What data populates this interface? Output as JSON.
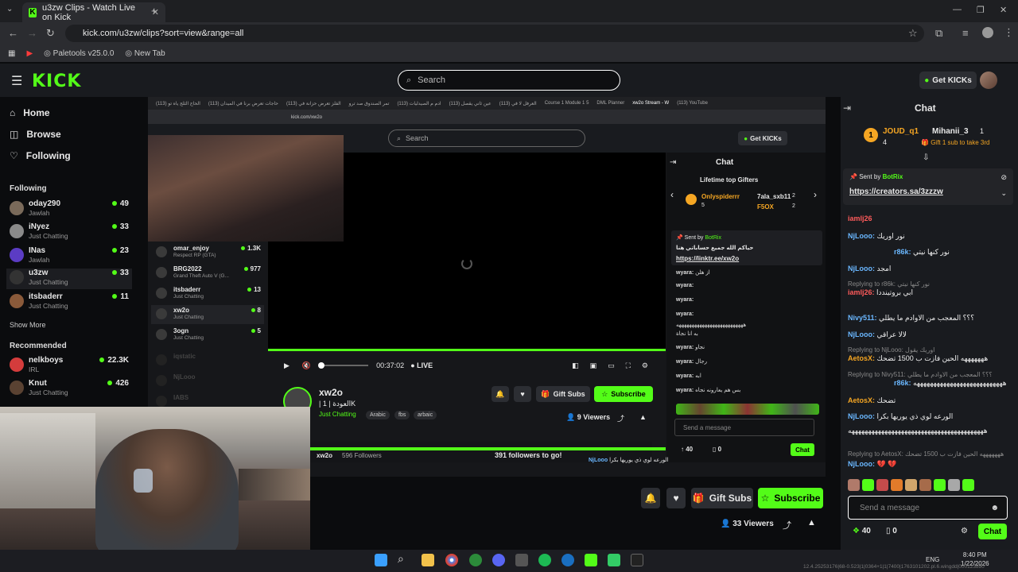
{
  "browser": {
    "tab_title": "u3zw Clips - Watch Live on Kick",
    "url": "kick.com/u3zw/clips?sort=view&range=all",
    "bookmarks": [
      "Paletools v25.0.0",
      "New Tab"
    ]
  },
  "header": {
    "logo": "KICK",
    "search_placeholder": "Search",
    "get_kicks": "Get KICKs"
  },
  "sidebar": {
    "nav": [
      "Home",
      "Browse",
      "Following"
    ],
    "following_title": "Following",
    "following": [
      {
        "name": "oday290",
        "category": "Jawlah",
        "viewers": "49",
        "color": "#7a6a5a"
      },
      {
        "name": "iNyez",
        "category": "Just Chatting",
        "viewers": "33",
        "color": "#8a8a8a"
      },
      {
        "name": "INas",
        "category": "Jawlah",
        "viewers": "23",
        "color": "#5b3cc4"
      },
      {
        "name": "u3zw",
        "category": "Just Chatting",
        "viewers": "33",
        "color": "#222"
      },
      {
        "name": "itsbaderr",
        "category": "Just Chatting",
        "viewers": "11",
        "color": "#8a5a3a"
      }
    ],
    "show_more": "Show More",
    "recommended_title": "Recommended",
    "recommended": [
      {
        "name": "nelkboys",
        "category": "IRL",
        "viewers": "22.3K",
        "color": "#d43c3c"
      },
      {
        "name": "Knut",
        "category": "Just Chatting",
        "viewers": "426",
        "color": "#5a4232"
      }
    ]
  },
  "shared_screen": {
    "tabs": [
      "(113) الحاج الثلج ياه تو",
      "(113) حاجات تعرض برنا في الميدان",
      "(113) الفلز تعرض حزانة في",
      "تمر الصندوق صد ترو",
      "(113) ادم م الصيدليات",
      "(113) عين ثاني يقصل",
      "(113) العرفل لا في",
      "Course 1 Module 1 5",
      "DML Planner",
      "xw2o Stream - W",
      "(113) YouTube"
    ],
    "url": "kick.com/xw2o",
    "search": "Search",
    "get_kicks": "Get KICKs",
    "time": "00:37:02",
    "live": "LIVE",
    "list": [
      {
        "name": "omar_enjoy",
        "category": "Respect RP (GTA)",
        "viewers": "1.3K",
        "dim": false
      },
      {
        "name": "BRG2022",
        "category": "Grand Theft Auto V (G...",
        "viewers": "977",
        "dim": false
      },
      {
        "name": "itsbaderr",
        "category": "Just Chatting",
        "viewers": "13",
        "dim": false
      },
      {
        "name": "xw2o",
        "category": "Just Chatting",
        "viewers": "8",
        "dim": false
      },
      {
        "name": "3ogn",
        "category": "Just Chatting",
        "viewers": "5",
        "dim": false
      },
      {
        "name": "iqstatic",
        "category": "",
        "viewers": "",
        "dim": true
      },
      {
        "name": "NjLooo",
        "category": "",
        "viewers": "",
        "dim": true
      },
      {
        "name": "IABS",
        "category": "",
        "viewers": "",
        "dim": true
      }
    ],
    "streamer": {
      "name": "xw2o",
      "title": "| العودة | 1K",
      "category": "Just Chatting",
      "tags": [
        "Arabic",
        "fbs",
        "arbaic"
      ],
      "viewers": "9 Viewers",
      "followers_name": "xw2o",
      "followers_count": "596 Followers",
      "followers_goal": "391 followers to go!"
    },
    "buttons": {
      "gift": "Gift Subs",
      "subscribe": "Subscribe"
    },
    "chat": {
      "title": "Chat",
      "gifters_title": "Lifetime top Gifters",
      "gifter1": "Onlyspiderrr",
      "gifter1_count": "5",
      "gifter2": "7ala_sxb11",
      "gifter2_count": "2",
      "gifter3": "F5OX",
      "gifter3_count": "2",
      "pinned_by": "Sent by",
      "pinned_user": "BotRix",
      "pinned_text": "حياكم الله جميع حساباتي هنا",
      "pinned_link": "https://linktr.ee/xw2o",
      "messages": [
        {
          "user": "wyara:",
          "text": "از هلن"
        },
        {
          "user": "wyara:",
          "text": ""
        },
        {
          "user": "wyara:",
          "text": ""
        },
        {
          "user": "wyara:",
          "text": ""
        },
        {
          "user": "",
          "text": "ههههههههههههههههههههههههههه"
        },
        {
          "user": "",
          "text": "به انا نجاة"
        },
        {
          "user": "wyara:",
          "text": "نجاو"
        },
        {
          "user": "wyara:",
          "text": "رجال"
        },
        {
          "user": "wyara:",
          "text": "ابه"
        },
        {
          "user": "wyara:",
          "text": "بس هم يعارونه نجاه"
        }
      ],
      "input": "Send a message",
      "count_a": "40",
      "count_b": "0",
      "send": "Chat",
      "bottom_user": "NjLooo",
      "bottom_text": "الورعه لوي ذي يوريها بكرا"
    }
  },
  "main_actions": {
    "gift": "Gift Subs",
    "subscribe": "Subscribe",
    "viewers": "33 Viewers"
  },
  "chat": {
    "title": "Chat",
    "gifter1_name": "JOUD_q1",
    "gifter1_count": "4",
    "gifter2_name": "Mihanii_3",
    "gifter2_count": "1",
    "gift_hint": "Gift 1 sub to take 3rd",
    "pinned_sent": "Sent by",
    "pinned_user": "BotRix",
    "pinned_link": "https://creators.sa/3zzzw",
    "messages": [
      {
        "user": "iamlj26",
        "text": "",
        "color": "#ff5b5b",
        "reply": ""
      },
      {
        "user": "NjLooo:",
        "text": "نور اوريك",
        "color": "#6ab7ff",
        "reply": ""
      },
      {
        "user": "r86k:",
        "text": "نور كنها نيتي",
        "color": "#6ab7ff",
        "reply": ""
      },
      {
        "user": "NjLooo:",
        "text": "امجد",
        "color": "#6ab7ff",
        "reply": ""
      },
      {
        "user": "iamlj26:",
        "text": "ابي بروتينددا",
        "color": "#ff5b5b",
        "reply": "Replying to r86k: نور كنها نيتي"
      },
      {
        "user": "Nivy511:",
        "text": "؟؟؟ المعجب من الاوادم ما يطلي",
        "color": "#6ab7ff",
        "reply": ""
      },
      {
        "user": "NjLooo:",
        "text": "لالا عراقي",
        "color": "#6ab7ff",
        "reply": ""
      },
      {
        "user": "AetosX:",
        "text": "هههههههه الحين فازت ب 1500 تضحك",
        "color": "#f5a623",
        "reply": "Replying to NjLooo: اوريك يقول"
      },
      {
        "user": "r86k:",
        "text": "هههههههههههههههههههههههههههه",
        "color": "#6ab7ff",
        "reply": "Replying to Nivy511: ؟؟؟ المعجب من الاوادم ما يطلي"
      },
      {
        "user": "AetosX:",
        "text": "تضحك",
        "color": "#f5a623",
        "reply": ""
      },
      {
        "user": "NjLooo:",
        "text": "الورعه لوي ذي يوريها بكرا",
        "color": "#6ab7ff",
        "reply": ""
      },
      {
        "user": "",
        "text": "هههههههههههههههههههههههههههههههههههههههههه",
        "color": "#eeeeee",
        "reply": ""
      },
      {
        "user": "",
        "text": "",
        "color": "#eeeeee",
        "reply": "Replying to AetosX: هههههههه الحين فازت ب 1500 تضحك"
      },
      {
        "user": "NjLooo:",
        "text": "💔 💔",
        "color": "#6ab7ff",
        "reply": ""
      }
    ],
    "input_placeholder": "Send a message",
    "count_a": "40",
    "count_b": "0",
    "send": "Chat"
  },
  "taskbar": {
    "lang": "ENG",
    "time": "8:40 PM",
    "date": "1/22/2026",
    "watermark": "12.4.25253176|68-0.523|1|0364+1|1|7400|1763101202.pl.6.wingdd|000123890"
  }
}
